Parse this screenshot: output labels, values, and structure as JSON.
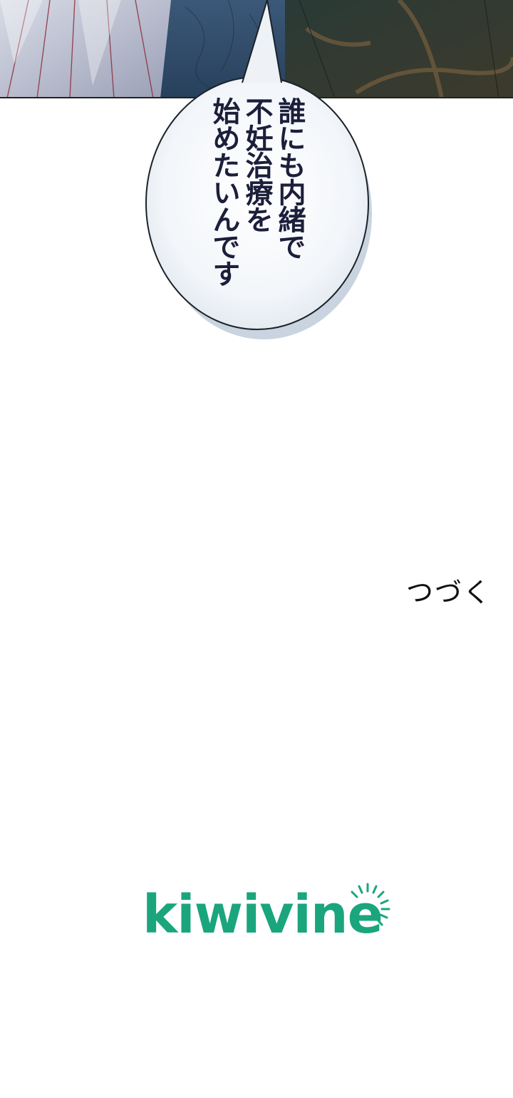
{
  "panel": {
    "speech_bubble": {
      "lines": [
        "誰にも内緒で",
        "不妊治療を",
        "始めたいんです"
      ]
    }
  },
  "ending": {
    "to_be_continued": "つづく"
  },
  "brand": {
    "logo_text": "kiwivine",
    "color": "#1aa57d"
  },
  "colors": {
    "text": "#1c1f3b",
    "bubble_fill": "#f2f5f9",
    "bubble_shadow": "#c9d4e0"
  }
}
